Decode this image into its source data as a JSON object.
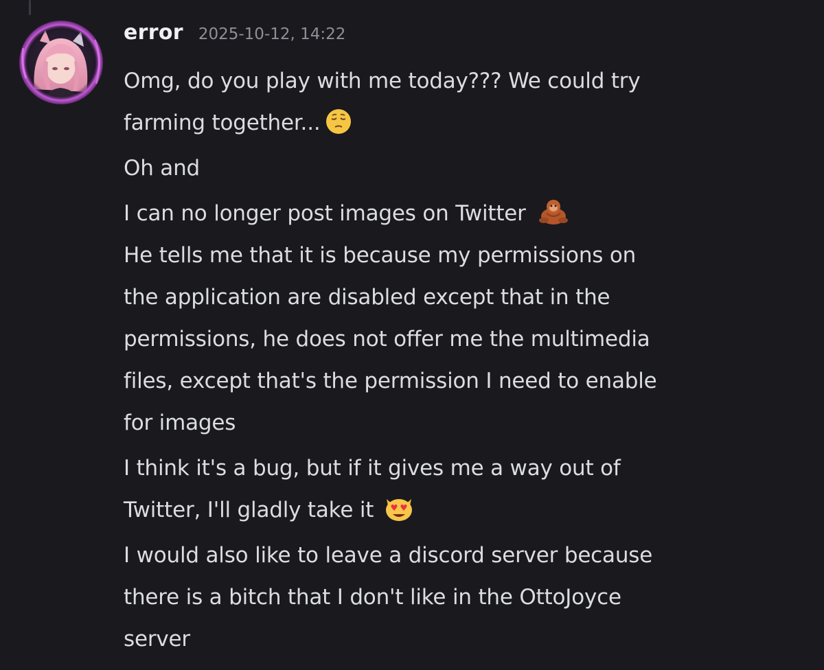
{
  "message": {
    "username": "error",
    "timestamp": "2025-10-12, 14:22",
    "avatar_icon": "anime-girl-avatar-icon",
    "colors": {
      "background": "#1a1a1e",
      "username": "#f0f0f3",
      "timestamp": "#8e9097",
      "text": "#dcdde1"
    },
    "paragraphs": [
      {
        "lines": [
          "Omg, do you play with me today??? We could try",
          "farming together..."
        ],
        "emoji": "pensive-face-emoji"
      },
      {
        "lines": [
          "Oh and"
        ]
      },
      {
        "lines": [
          "I can no longer post images on Twitter"
        ],
        "emoji": "orangutan-emoji"
      },
      {
        "lines": [
          "He tells me that it is because my permissions on",
          "the application are disabled except that in the",
          "permissions, he does not offer me the multimedia",
          "files, except that's the permission I need to enable",
          "for images"
        ]
      },
      {
        "lines": [
          "I think it's a bug, but if it gives me a way out of",
          "Twitter, I'll gladly take it"
        ],
        "emoji": "heart-eyes-cat-emoji"
      },
      {
        "lines": [
          "I would also like to leave a discord server because",
          "there is a bitch that I don't like in the OttoJoyce",
          "server"
        ]
      }
    ]
  }
}
